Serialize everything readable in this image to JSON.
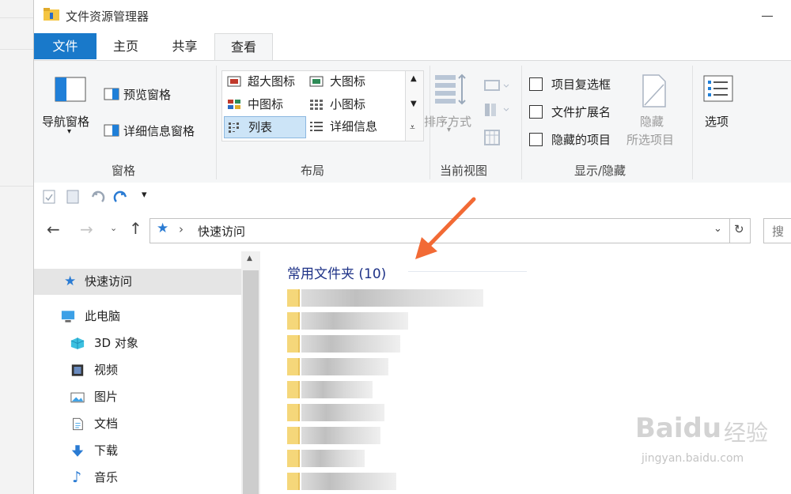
{
  "window": {
    "title": "文件资源管理器"
  },
  "tabs": [
    "文件",
    "主页",
    "共享",
    "查看"
  ],
  "ribbon": {
    "panes": {
      "nav_pane": "导航窗格",
      "preview_pane": "预览窗格",
      "details_pane": "详细信息窗格",
      "label": "窗格"
    },
    "layout": {
      "items": [
        "超大图标",
        "大图标",
        "中图标",
        "小图标",
        "列表",
        "详细信息"
      ],
      "selected": "列表",
      "label": "布局"
    },
    "current_view": {
      "sort_by": "排序方式",
      "label": "当前视图"
    },
    "show_hide": {
      "checkboxes": [
        "项目复选框",
        "文件扩展名",
        "隐藏的项目"
      ],
      "hide_selected": "隐藏",
      "hide_selected_2": "所选项目",
      "label": "显示/隐藏"
    },
    "options": "选项"
  },
  "address": {
    "crumb": "快速访问",
    "search_partial": "搜"
  },
  "nav": {
    "quick_access": "快速访问",
    "this_pc": "此电脑",
    "items": [
      "3D 对象",
      "视频",
      "图片",
      "文档",
      "下载",
      "音乐"
    ]
  },
  "content": {
    "group_title": "常用文件夹 (10)"
  },
  "watermark": {
    "brand": "Baidu",
    "brand_cn": "经验",
    "url": "jingyan.baidu.com"
  },
  "colors": {
    "accent": "#1979ca",
    "group_title": "#1e3287",
    "annotation_arrow": "#f26a35"
  }
}
